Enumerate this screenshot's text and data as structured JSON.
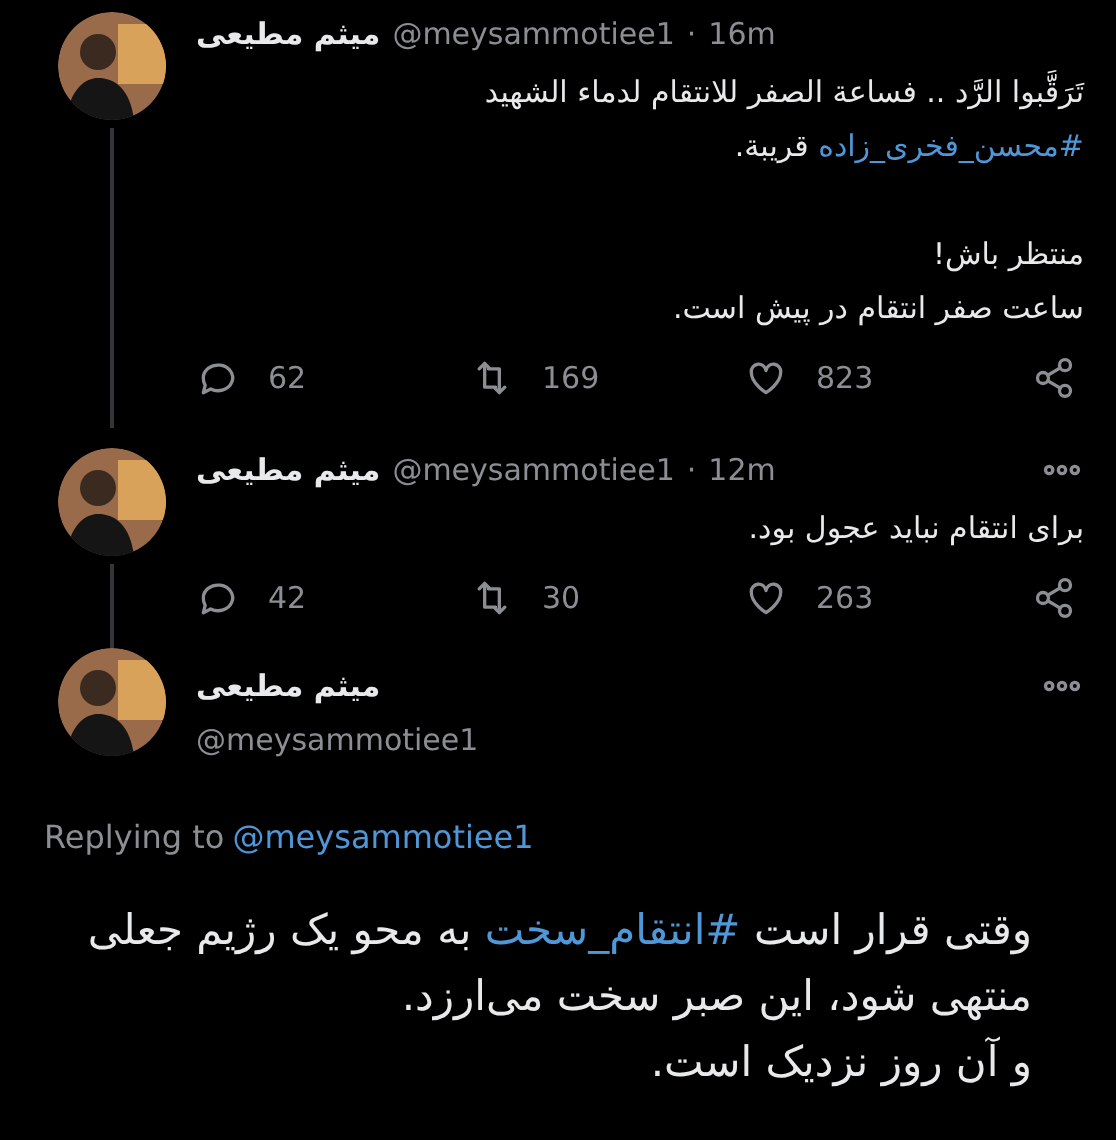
{
  "thread": [
    {
      "name": "میثم مطیعی",
      "handle": "@meysammotiee1",
      "separator": "·",
      "time": "16m",
      "menu": false,
      "body": [
        {
          "kind": "text",
          "text": "تَرَقَّبوا الرَّد .. فساعة الصفر للانتقام لدماء الشهيد\n"
        },
        {
          "kind": "hashtag",
          "text": "#محسن_فخری_زاده"
        },
        {
          "kind": "text",
          "text": " قريبة.\n\nمنتظر باش!\nساعت صفر انتقام در پیش است."
        }
      ],
      "actions": {
        "replies": "62",
        "retweets": "169",
        "likes": "823"
      }
    },
    {
      "name": "میثم مطیعی",
      "handle": "@meysammotiee1",
      "separator": "·",
      "time": "12m",
      "menu": true,
      "body": [
        {
          "kind": "text",
          "text": "برای انتقام نباید عجول بود."
        }
      ],
      "actions": {
        "replies": "42",
        "retweets": "30",
        "likes": "263"
      }
    }
  ],
  "focused": {
    "name": "میثم مطیعی",
    "handle": "@meysammotiee1",
    "menu": true,
    "replying_label": "Replying to",
    "replying_to": "@meysammotiee1",
    "body": [
      {
        "kind": "text",
        "text": "وقتی قرار است "
      },
      {
        "kind": "hashtag",
        "text": "#انتقام_سخت"
      },
      {
        "kind": "text",
        "text": " به محو یک رژیم جعلی منتهی شود، این صبر سخت می‌ارزد.\nو آن روز نزدیک است."
      }
    ]
  }
}
